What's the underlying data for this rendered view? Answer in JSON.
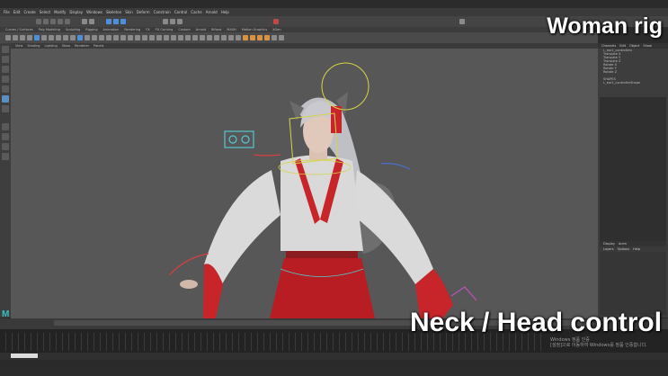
{
  "overlay": {
    "title": "Woman rig",
    "caption": "Neck / Head control",
    "windows_notice_line1": "Windows 정품 인증",
    "windows_notice_line2": "[설정]으로 이동하여 Windows를 정품 인증합니다."
  },
  "menubar": {
    "items": [
      "File",
      "Edit",
      "Create",
      "Select",
      "Modify",
      "Display",
      "Windows",
      "Skeleton",
      "Skin",
      "Deform",
      "Constrain",
      "Control",
      "Cache",
      "Arnold",
      "Help"
    ]
  },
  "shelf_tabs": [
    "Curves / Surfaces",
    "Poly Modeling",
    "Sculpting",
    "Rigging",
    "Animation",
    "Rendering",
    "FX",
    "FX Caching",
    "Custom",
    "Arnold",
    "Bifrost",
    "MASH",
    "Motion Graphics",
    "XGen"
  ],
  "viewport_menu": [
    "View",
    "Shading",
    "Lighting",
    "Show",
    "Renderer",
    "Panels"
  ],
  "right_panel": {
    "tabs": [
      "Channels",
      "Edit",
      "Object",
      "Show"
    ],
    "object_name": "L_ear1_controllers",
    "channels": [
      "Translate X",
      "Translate Y",
      "Translate Z",
      "Rotate X",
      "Rotate Y",
      "Rotate Z"
    ],
    "shapes_header": "SHAPES",
    "shape_name": "L_ear1_controllerShape",
    "lower_tabs": [
      "Display",
      "Anim"
    ],
    "lower_menu": [
      "Layers",
      "Options",
      "Help"
    ]
  },
  "colors": {
    "viewport_bg": "#575757",
    "robe_white": "#d9d9d9",
    "robe_red": "#c8252a",
    "hakama_red": "#b81d23",
    "hair": "#c9c9cf",
    "ctrl_yellow": "#d6d448",
    "ctrl_blue": "#4a6fd0",
    "ctrl_cyan": "#56c8d0",
    "ctrl_red": "#d84040",
    "ctrl_magenta": "#c050c0"
  }
}
